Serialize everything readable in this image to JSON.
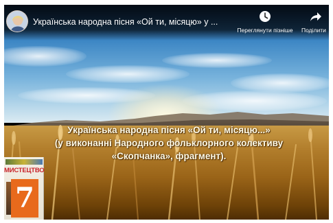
{
  "video": {
    "title": "Українська народна пісня «Ой ти, місяцю» у ...",
    "actions": {
      "watch_later": {
        "label": "Переглянути пізніше",
        "icon": "clock-icon"
      },
      "share": {
        "label": "Поділити",
        "icon": "share-arrow-icon"
      }
    }
  },
  "overlay": {
    "line1": "Українська народна пісня «Ой ти, місяцю...»",
    "line2": "(у виконанні Народного фольклорного колективу",
    "line3": "«Скопчанка», фрагмент)."
  },
  "book": {
    "title": "МИСТЕЦТВО",
    "grade": "7"
  },
  "colors": {
    "caption_text": "#fffbe8",
    "book_title": "#c8232b",
    "book_accent": "#e86a1c"
  }
}
